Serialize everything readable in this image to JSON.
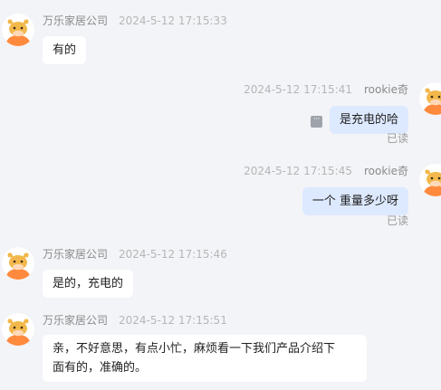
{
  "messages": [
    {
      "sender": "万乐家居公司",
      "time": "2024-5-12 17:15:33",
      "text": "有的"
    },
    {
      "sender": "rookie奇",
      "time": "2024-5-12 17:15:41",
      "text": "是充电的哈",
      "status": "已读"
    },
    {
      "sender": "rookie奇",
      "time": "2024-5-12 17:15:45",
      "text": "一个 重量多少呀",
      "status": "已读"
    },
    {
      "sender": "万乐家居公司",
      "time": "2024-5-12 17:15:46",
      "text": "是的，充电的"
    },
    {
      "sender": "万乐家居公司",
      "time": "2024-5-12 17:15:51",
      "text_line1": "亲，不好意思，有点小忙，麻烦看一下我们产品介绍下",
      "text_line2": "面有的，准确的。"
    }
  ],
  "more_icon_glyph": "···",
  "colors": {
    "background": "#f3f4f7",
    "incoming_bubble": "#ffffff",
    "outgoing_bubble": "#dde9ff",
    "avatar_bg": "#ffffff",
    "avatar_orange": "#ff8a3d",
    "avatar_horn": "#f2b84b"
  }
}
